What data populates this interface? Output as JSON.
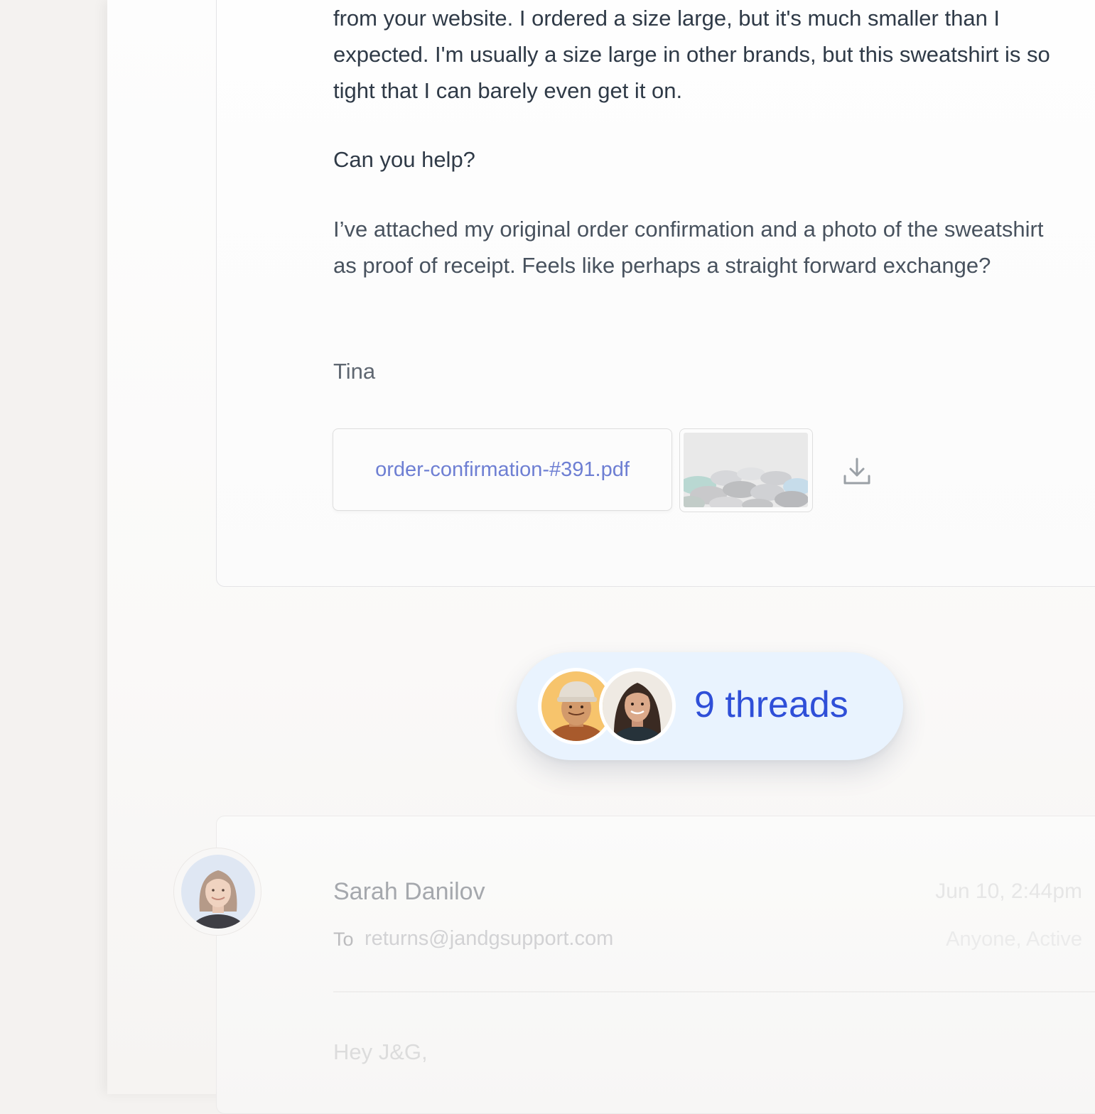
{
  "message": {
    "paragraph1": "from your website. I ordered a size large, but it's much smaller than I expected. I'm usually a size large in other brands, but this sweatshirt is so tight that I can barely even get it on.",
    "paragraph2": "Can you help?",
    "paragraph3": "I’ve attached my original order confirmation and a photo of the sweatshirt as proof of receipt. Feels like perhaps a straight forward exchange?",
    "signature": "Tina",
    "attachments": {
      "pdf_name": "order-confirmation-#391.pdf",
      "image_icon": "sweatshirt-photo-thumbnail",
      "download_icon": "download-icon"
    }
  },
  "threads": {
    "label": "9 threads",
    "avatars": [
      "participant-avatar-man",
      "participant-avatar-woman"
    ]
  },
  "reply": {
    "sender_name": "Sarah Danilov",
    "date": "Jun 10, 2:44pm",
    "to_label": "To",
    "to_address": "returns@jandgsupport.com",
    "assignee": "Anyone, Active",
    "greeting": "Hey J&G,"
  },
  "colors": {
    "link": "#6e7fd3",
    "threads_text": "#2f4fd8",
    "threads_bg": "#e9f3fe",
    "body_text": "#2f3a47"
  }
}
